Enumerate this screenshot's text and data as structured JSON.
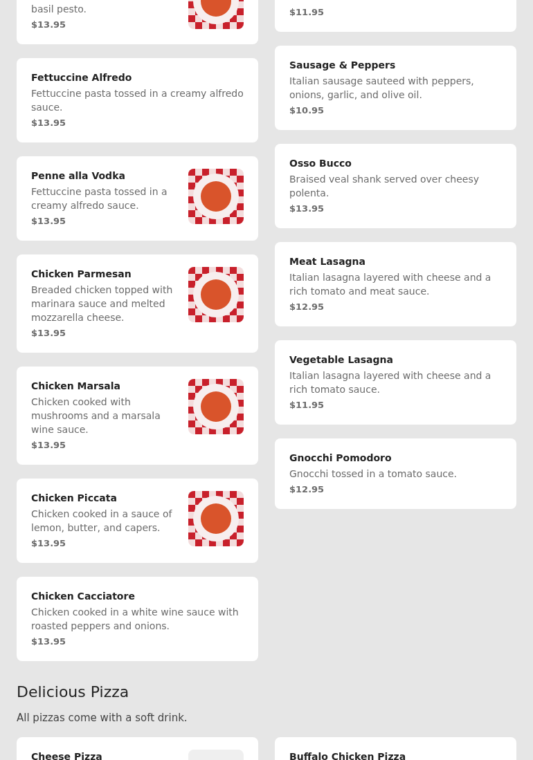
{
  "sections": [
    {
      "columns": [
        [
          {
            "description": "basil pesto.",
            "price": "$13.95",
            "kind": "plate"
          },
          {
            "name": "Fettuccine Alfredo",
            "description": "Fettuccine pasta tossed in a creamy alfredo sauce.",
            "price": "$13.95"
          },
          {
            "name": "Penne alla Vodka",
            "description": "Fettuccine pasta tossed in a creamy alfredo sauce.",
            "price": "$13.95",
            "kind": "plate"
          },
          {
            "name": "Chicken Parmesan",
            "description": "Breaded chicken topped with marinara sauce and melted mozzarella cheese.",
            "price": "$13.95",
            "kind": "plate"
          },
          {
            "name": "Chicken Marsala",
            "description": "Chicken cooked with mushrooms and a marsala wine sauce.",
            "price": "$13.95",
            "kind": "plate"
          },
          {
            "name": "Chicken Piccata",
            "description": "Chicken cooked in a sauce of lemon, butter, and capers.",
            "price": "$13.95",
            "kind": "plate"
          },
          {
            "name": "Chicken Cacciatore",
            "description": "Chicken cooked in a white wine sauce with roasted peppers and onions.",
            "price": "$13.95"
          }
        ],
        [
          {
            "price": "$11.95"
          },
          {
            "name": "Sausage & Peppers",
            "description": "Italian sausage sauteed with peppers, onions, garlic, and olive oil.",
            "price": "$10.95"
          },
          {
            "name": "Osso Bucco",
            "description": "Braised veal shank served over cheesy polenta.",
            "price": "$13.95"
          },
          {
            "name": "Meat Lasagna",
            "description": "Italian lasagna layered with cheese and a rich tomato and meat sauce.",
            "price": "$12.95"
          },
          {
            "name": "Vegetable Lasagna",
            "description": "Italian lasagna layered with cheese and a rich tomato sauce.",
            "price": "$11.95"
          },
          {
            "name": "Gnocchi Pomodoro",
            "description": "Gnocchi tossed in a tomato sauce.",
            "price": "$12.95"
          }
        ]
      ]
    },
    {
      "title": "Delicious Pizza",
      "subtitle": "All pizzas come with a soft drink.",
      "columns": [
        [
          {
            "name": "Cheese Pizza",
            "kind": "pizza"
          }
        ],
        [
          {
            "name": "Buffalo Chicken Pizza"
          }
        ]
      ]
    }
  ]
}
